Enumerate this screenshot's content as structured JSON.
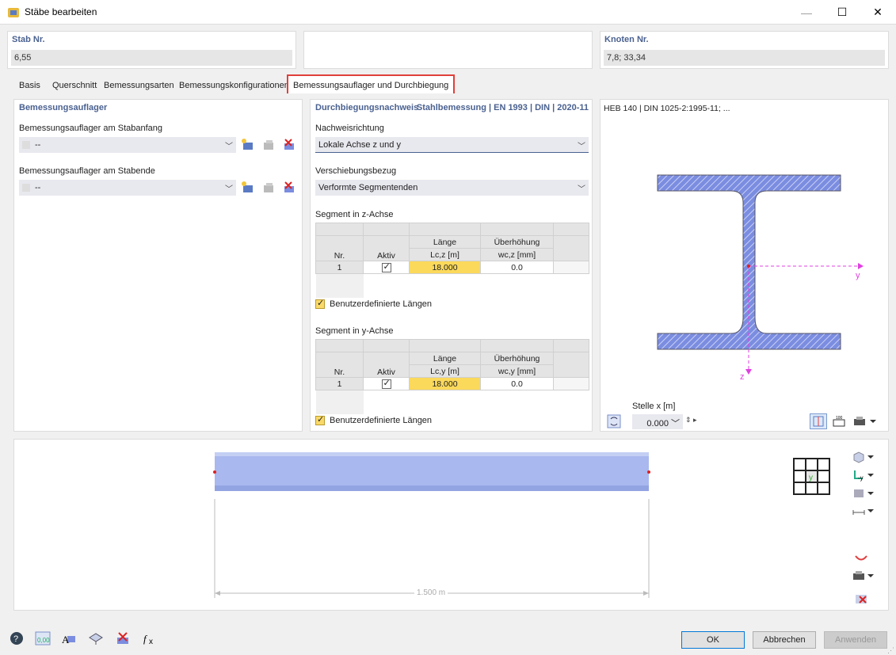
{
  "window": {
    "title": "Stäbe bearbeiten",
    "minimize": "—",
    "maximize": "☐",
    "close": "✕"
  },
  "stab": {
    "label": "Stab Nr.",
    "value": "6,55"
  },
  "knoten": {
    "label": "Knoten Nr.",
    "value": "7,8; 33,34"
  },
  "tabs": [
    "Basis",
    "Querschnitt",
    "Bemessungsarten",
    "Bemessungskonfigurationen",
    "Bemessungsauflager und Durchbiegung"
  ],
  "left": {
    "header": "Bemessungsauflager",
    "start_label": "Bemessungsauflager am Stabanfang",
    "start_value": "--",
    "end_label": "Bemessungsauflager am Stabende",
    "end_value": "--"
  },
  "mid": {
    "header": "Durchbiegungsnachweis",
    "norm": "Stahlbemessung | EN 1993 | DIN | 2020-11",
    "dir_label": "Nachweisrichtung",
    "dir_value": "Lokale Achse z und y",
    "ref_label": "Verschiebungsbezug",
    "ref_value": "Verformte Segmentenden",
    "segz": {
      "label": "Segment in z-Achse",
      "col_nr": "Nr.",
      "col_aktiv": "Aktiv",
      "col_laenge": "Länge",
      "col_ueber": "Überhöhung",
      "unit_laenge": "Lc,z [m]",
      "unit_ueber": "wc,z [mm]",
      "rows": [
        {
          "nr": "1",
          "aktiv": true,
          "laenge": "18.000",
          "ueber": "0.0"
        }
      ],
      "custom": "Benutzerdefinierte Längen"
    },
    "segy": {
      "label": "Segment in y-Achse",
      "col_nr": "Nr.",
      "col_aktiv": "Aktiv",
      "col_laenge": "Länge",
      "col_ueber": "Überhöhung",
      "unit_laenge": "Lc,y [m]",
      "unit_ueber": "wc,y [mm]",
      "rows": [
        {
          "nr": "1",
          "aktiv": true,
          "laenge": "18.000",
          "ueber": "0.0"
        }
      ],
      "custom": "Benutzerdefinierte Längen"
    }
  },
  "section": {
    "title": "HEB 140 | DIN 1025-2:1995-11; ...",
    "axis_y": "y",
    "axis_z": "z",
    "stelle_label": "Stelle x [m]",
    "stelle_value": "0.000"
  },
  "beam": {
    "dimension": "1.500 m",
    "axis_label": "y"
  },
  "buttons": {
    "ok": "OK",
    "cancel": "Abbrechen",
    "apply": "Anwenden"
  },
  "colors": {
    "accent": "#4a6190",
    "tab_highlight": "#e0403a",
    "beam": "#a9b8ee",
    "section_fill": "#7b8de0",
    "axis": "#e040e0"
  }
}
